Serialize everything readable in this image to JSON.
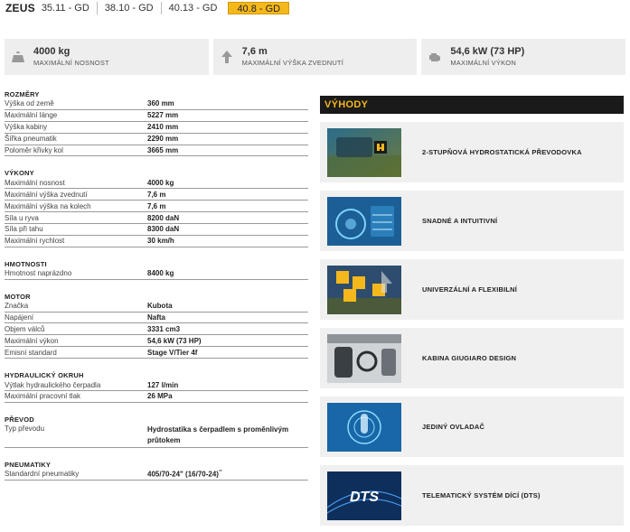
{
  "header": {
    "brand": "ZEUS",
    "tabs": [
      {
        "label": "35.11 - GD",
        "active": false
      },
      {
        "label": "38.10 - GD",
        "active": false
      },
      {
        "label": "40.13 - GD",
        "active": false
      },
      {
        "label": "40.8 - GD",
        "active": true
      }
    ]
  },
  "kpis": [
    {
      "icon": "weight-icon",
      "value": "4000 kg",
      "label": "MAXIMÁLNÍ NOSNOST"
    },
    {
      "icon": "arrow-up-icon",
      "value": "7,6 m",
      "label": "MAXIMÁLNÍ VÝŠKA ZVEDNUTÍ"
    },
    {
      "icon": "engine-icon",
      "value": "54,6 kW (73 HP)",
      "label": "MAXIMÁLNÍ VÝKON"
    }
  ],
  "specs": {
    "rozmery": {
      "title": "ROZMĚRY",
      "rows": [
        {
          "k": "Výška od země",
          "v": "360 mm"
        },
        {
          "k": "Maximální länge",
          "v": "5227 mm"
        },
        {
          "k": "Výška kabiny",
          "v": "2410 mm"
        },
        {
          "k": "Šířka pneumatik",
          "v": "2290 mm"
        },
        {
          "k": "Poloměr křivky kol",
          "v": "3665 mm"
        }
      ]
    },
    "vykony": {
      "title": "VÝKONY",
      "rows": [
        {
          "k": "Maximální nosnost",
          "v": "4000 kg"
        },
        {
          "k": "Maximální výška zvednutí",
          "v": "7,6 m"
        },
        {
          "k": "Maximální výška na kolech",
          "v": "7,6 m"
        },
        {
          "k": "Síla u ryva",
          "v": "8200 daN"
        },
        {
          "k": "Síla při tahu",
          "v": "8300 daN"
        },
        {
          "k": "Maximální rychlost",
          "v": "30 km/h"
        }
      ]
    },
    "hmotnosti": {
      "title": "HMOTNOSTI",
      "rows": [
        {
          "k": "Hmotnost naprázdno",
          "v": "8400 kg"
        }
      ]
    },
    "motor": {
      "title": "MOTOR",
      "rows": [
        {
          "k": "Značka",
          "v": "Kubota"
        },
        {
          "k": "Napájení",
          "v": "Nafta"
        },
        {
          "k": "Objem válců",
          "v": "3331 cm3"
        },
        {
          "k": "Maximální výkon",
          "v": "54,6 kW (73 HP)"
        },
        {
          "k": "Emisní standard",
          "v": "Stage V/Tier 4f"
        }
      ]
    },
    "hydraulika": {
      "title": "HYDRAULICKÝ OKRUH",
      "rows": [
        {
          "k": "Výtlak hydraulického čerpadla",
          "v": "127 l/min"
        },
        {
          "k": "Maximální pracovní tlak",
          "v": "26 MPa"
        }
      ]
    },
    "prevod": {
      "title": "PŘEVOD",
      "rows": [
        {
          "k": "Typ převodu",
          "v": "Hydrostatika s čerpadlem s proměnlivým průtokem"
        }
      ]
    },
    "pneumatiky": {
      "title": "PNEUMATIKY",
      "rows": [
        {
          "k": "Standardní pneumatiky",
          "v": "405/70-24\" (16/70-24)",
          "sup": "**"
        }
      ]
    }
  },
  "advantages": {
    "title": "VÝHODY",
    "items": [
      {
        "label": "2-STUPŇOVÁ HYDROSTATICKÁ PŘEVODOVKA"
      },
      {
        "label": "SNADNÉ A INTUITIVNÍ"
      },
      {
        "label": "UNIVERZÁLNÍ A FLEXIBILNÍ"
      },
      {
        "label": "KABINA GIUGIARO DESIGN"
      },
      {
        "label": "JEDINÝ OVLADAČ"
      },
      {
        "label": "TELEMATICKÝ SYSTÉM DÍCÍ (DTS)",
        "thumb_text": "DTS"
      }
    ]
  },
  "colors": {
    "accent": "#f5b81c",
    "card_bg": "#eeeeee",
    "header_bg": "#1a1a1a"
  }
}
